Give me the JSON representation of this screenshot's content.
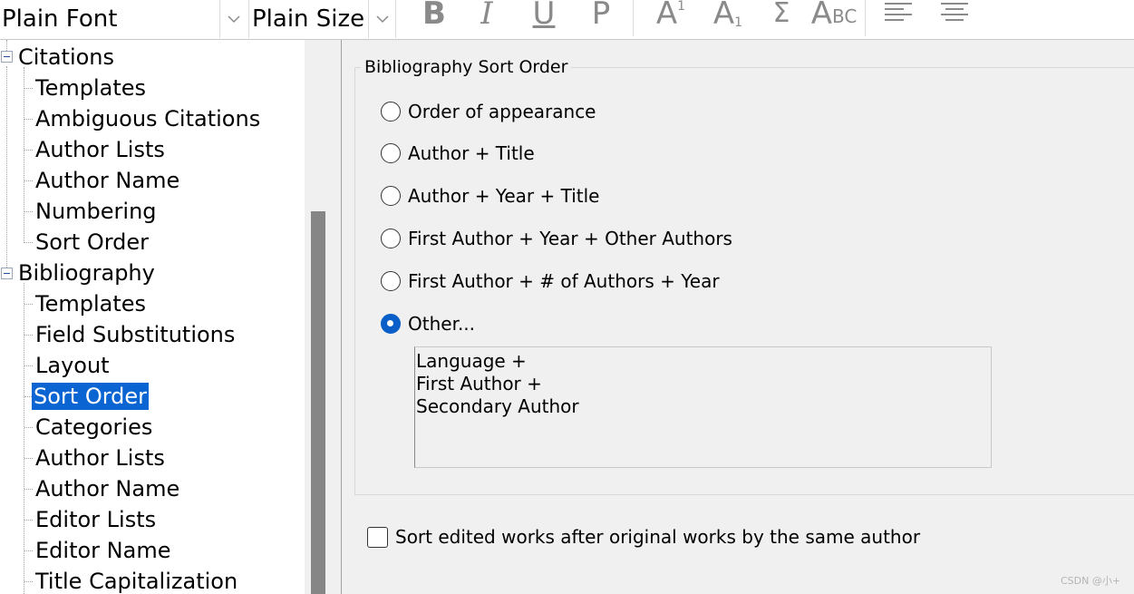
{
  "toolbar": {
    "font_combo": "Plain Font",
    "size_combo": "Plain Size",
    "bold": "B",
    "italic": "I",
    "underline": "U",
    "plain": "P",
    "superscript": "A",
    "superscript_mark": "1",
    "subscript": "A",
    "subscript_mark": "1",
    "symbol": "Σ",
    "smallcaps_a": "A",
    "smallcaps_bc": "BC"
  },
  "tree": {
    "citations_label": "Citations",
    "citations_children": [
      "Templates",
      "Ambiguous Citations",
      "Author Lists",
      "Author Name",
      "Numbering",
      "Sort Order"
    ],
    "bibliography_label": "Bibliography",
    "bibliography_children": [
      "Templates",
      "Field Substitutions",
      "Layout",
      "Sort Order",
      "Categories",
      "Author Lists",
      "Author Name",
      "Editor Lists",
      "Editor Name",
      "Title Capitalization"
    ],
    "selected": "Bibliography/Sort Order"
  },
  "sort_order": {
    "group_title": "Bibliography Sort Order",
    "options": [
      {
        "label": "Order of appearance",
        "checked": false
      },
      {
        "label": "Author + Title",
        "checked": false
      },
      {
        "label": "Author + Year + Title",
        "checked": false
      },
      {
        "label": "First Author + Year + Other Authors",
        "checked": false
      },
      {
        "label": "First Author + # of Authors + Year",
        "checked": false
      },
      {
        "label": "Other...",
        "checked": true
      }
    ],
    "other_value": "Language +\nFirst Author +\nSecondary Author",
    "sort_edited_label": "Sort edited works after original works by the same author",
    "sort_edited_checked": false
  },
  "watermark": "CSDN @小+"
}
